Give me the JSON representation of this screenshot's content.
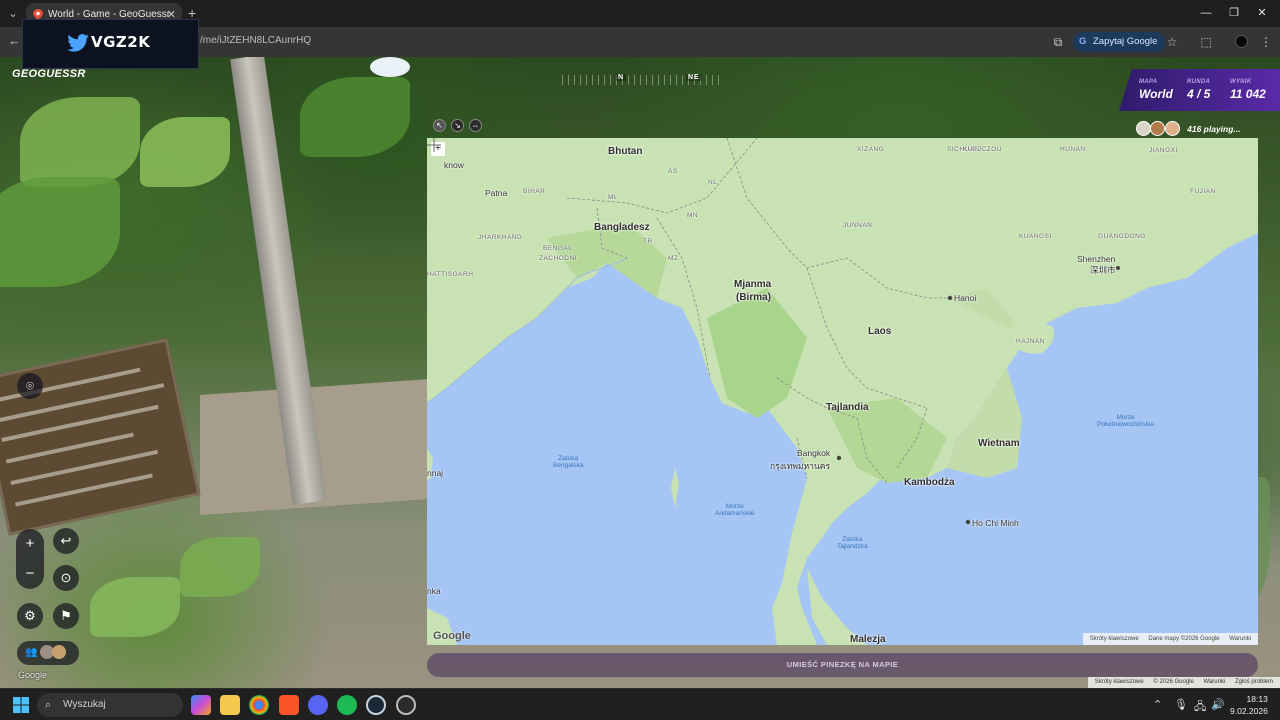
{
  "browser": {
    "tab_title": "World - Game - GeoGuessr",
    "url": "/me/iJtZEHN8LCAunrHQ",
    "ask_google": "Zapytaj Google"
  },
  "overlay": {
    "logo_text": "VGZ2K"
  },
  "game": {
    "brand": "GEOGUESSR",
    "compass": {
      "north": "N",
      "northeast": "NE"
    },
    "status": {
      "map_label": "MAPA",
      "map_value": "World",
      "round_label": "RUNDA",
      "round_value": "4 / 5",
      "score_label": "WYNIK",
      "score_value": "11 042"
    },
    "players": "416 playing...",
    "place_pin": "UMIEŚĆ PINEZKĘ NA MAPIE",
    "sv_google": "Google",
    "sv_attrib": [
      "Skróty klawiszowe",
      "© 2026 Google",
      "Warunki",
      "Zgłoś problem"
    ]
  },
  "map": {
    "countries": [
      "Bhutan",
      "Bangladesz",
      "Mjanma",
      "(Birma)",
      "Laos",
      "Tajlandia",
      "Wietnam",
      "Kambodża",
      "Malezja"
    ],
    "regions": [
      "BIHAR",
      "JHARKHAND",
      "BENGAL",
      "ZACHODNI",
      "HATTISGARH",
      "AS",
      "NL",
      "ML",
      "MN",
      "TR",
      "MZ",
      "XIZANG",
      "SICHUAN",
      "KUEJCZOU",
      "HUNAN",
      "JIANGXI",
      "FUJIAN",
      "JUNNAN",
      "KUANGSI",
      "GUANGDONG",
      "HAJNAN"
    ],
    "cities": [
      "know",
      "Patna",
      "Hanoi",
      "Shenzhen",
      "深圳市",
      "Bangkok",
      "กรุงเทพมหานคร",
      "Ho Chi Minh",
      "nnaj",
      "nka"
    ],
    "seas": [
      "Zatoka",
      "Bengalska",
      "Morze",
      "Andamańskie",
      "Zatoka",
      "Tajlandzka",
      "Morze",
      "Południowochińskie"
    ],
    "google": "Google",
    "attrib": [
      "Skróty klawiszowe",
      "Dane mapy ©2026 Google",
      "Warunki"
    ]
  },
  "taskbar": {
    "search": "Wyszukaj",
    "time": "18:13",
    "date": "9.02.2026"
  },
  "colors": {
    "water": "#a5c6f5",
    "land": "#c9e2b3",
    "status_panel": "#4a23a0",
    "accent": "#8ab4f8"
  }
}
